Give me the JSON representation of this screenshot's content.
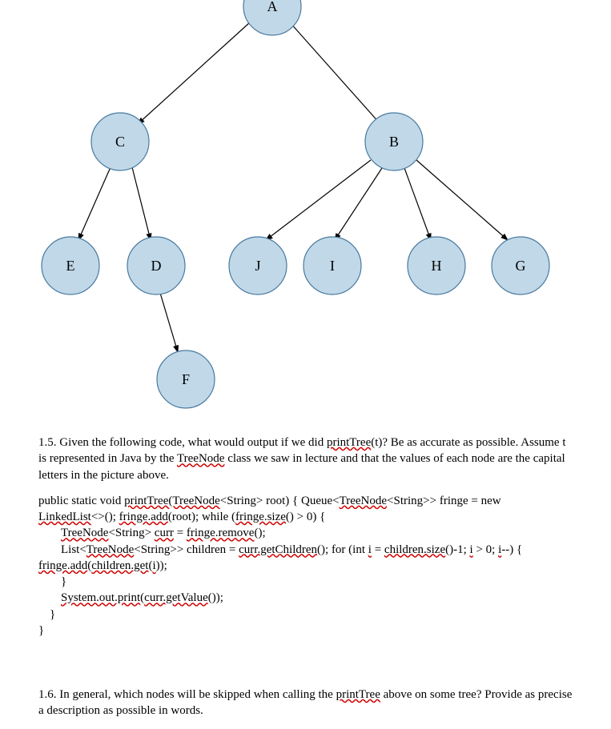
{
  "tree": {
    "A": "A",
    "B": "B",
    "C": "C",
    "D": "D",
    "E": "E",
    "F": "F",
    "G": "G",
    "H": "H",
    "I": "I",
    "J": "J"
  },
  "q15": {
    "prefix": "1.5. Given the following code, what would output if we did ",
    "printTree": "printTree",
    "afterPrint": "(t)? Be as accurate as possible. Assume t is represented in Java by the ",
    "treeNode": "TreeNode",
    "tail": " class we saw in lecture and that the values of each node are the capital letters in the picture above."
  },
  "code": {
    "l1a": "public static void ",
    "l1b": "printTree(TreeNode",
    "l1c": "<String> root) {   Queue<",
    "l1d": "TreeNode",
    "l1e": "<String>> fringe = new",
    "l2a": "LinkedList",
    "l2b": "<>();   ",
    "l2c": "fringe.add",
    "l2d": "(root);   while (",
    "l2e": "fringe.size",
    "l2f": "() > 0) {",
    "l3a": "TreeNode",
    "l3b": "<String> ",
    "l3c": "curr",
    "l3d": " = ",
    "l3e": "fringe.remove",
    "l3f": "();",
    "l4a": "List<",
    "l4b": "TreeNode",
    "l4c": "<String>> children = ",
    "l4d": "curr.getChildren",
    "l4e": "();    for (int ",
    "l4f": "i",
    "l4g": " = ",
    "l4h": "children.size",
    "l4i": "()-1; ",
    "l4j": "i",
    "l4k": " > 0; ",
    "l4l": "i",
    "l4m": "--) {",
    "l5a": "fringe.add",
    "l5b": "(",
    "l5c": "children.get",
    "l5d": "(",
    "l5e": "i",
    "l5f": "));",
    "l6": "}",
    "l7a": "System.out.print",
    "l7b": "(",
    "l7c": "curr.getValue",
    "l7d": "());",
    "l8": "}",
    "l9": "}"
  },
  "q16": {
    "prefix": "1.6. In general, which nodes will be skipped when calling the ",
    "printTree": "printTree",
    "tail": " above on some tree? Provide as precise a description as possible in words."
  }
}
